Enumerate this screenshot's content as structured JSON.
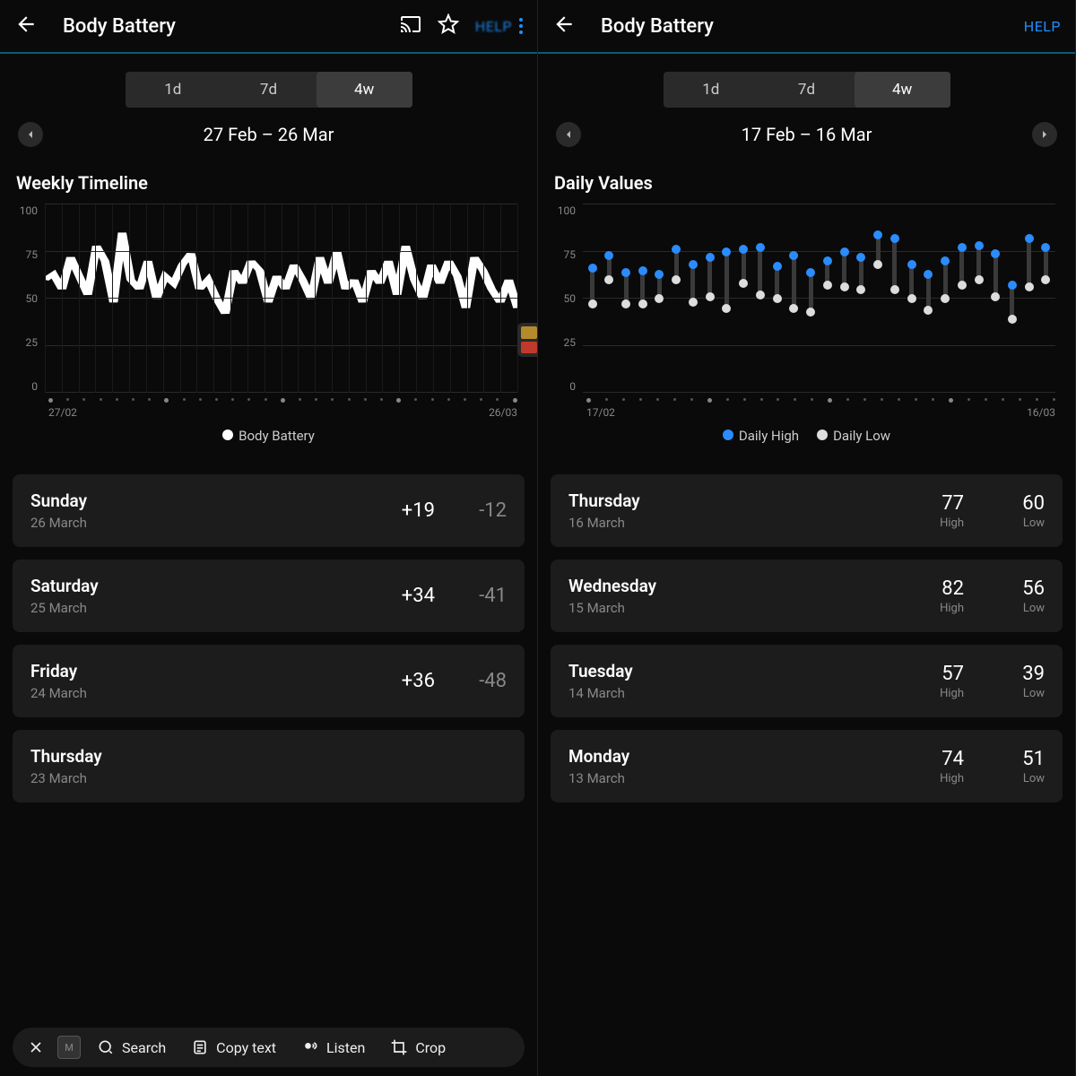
{
  "left": {
    "title": "Body Battery",
    "help": "HELP",
    "tabs": [
      "1d",
      "7d",
      "4w"
    ],
    "activeTab": "4w",
    "dateRange": "27 Feb – 26 Mar",
    "section": "Weekly Timeline",
    "legend": "Body Battery",
    "xaxis": {
      "start": "27/02",
      "end": "26/03"
    },
    "rows": [
      {
        "day": "Sunday",
        "date": "26 March",
        "pos": "+19",
        "neg": "-12"
      },
      {
        "day": "Saturday",
        "date": "25 March",
        "pos": "+34",
        "neg": "-41"
      },
      {
        "day": "Friday",
        "date": "24 March",
        "pos": "+36",
        "neg": "-48"
      },
      {
        "day": "Thursday",
        "date": "23 March",
        "pos": "",
        "neg": ""
      }
    ],
    "toolbar": {
      "close": "×",
      "search": "Search",
      "copy": "Copy text",
      "listen": "Listen",
      "crop": "Crop"
    }
  },
  "right": {
    "title": "Body Battery",
    "help": "HELP",
    "tabs": [
      "1d",
      "7d",
      "4w"
    ],
    "activeTab": "4w",
    "dateRange": "17 Feb – 16 Mar",
    "section": "Daily Values",
    "legend": {
      "hi": "Daily High",
      "lo": "Daily Low"
    },
    "xaxis": {
      "start": "17/02",
      "end": "16/03"
    },
    "rows": [
      {
        "day": "Thursday",
        "date": "16 March",
        "hi": "77",
        "lo": "60"
      },
      {
        "day": "Wednesday",
        "date": "15 March",
        "hi": "82",
        "lo": "56"
      },
      {
        "day": "Tuesday",
        "date": "14 March",
        "hi": "57",
        "lo": "39"
      },
      {
        "day": "Monday",
        "date": "13 March",
        "hi": "74",
        "lo": "51"
      }
    ]
  },
  "chart_data": [
    {
      "type": "line",
      "title": "Weekly Timeline",
      "ylabel": "Body Battery",
      "ylim": [
        0,
        100
      ],
      "x_start": "27/02",
      "x_end": "26/03",
      "series": [
        {
          "name": "Body Battery",
          "values": [
            60,
            63,
            55,
            72,
            62,
            52,
            78,
            70,
            48,
            85,
            60,
            55,
            70,
            50,
            62,
            58,
            68,
            74,
            55,
            60,
            50,
            42,
            65,
            58,
            70,
            65,
            48,
            62,
            55,
            68,
            60,
            50,
            72,
            58,
            75,
            55,
            60,
            48,
            65,
            58,
            70,
            52,
            78,
            60,
            50,
            68,
            58,
            70,
            62,
            45,
            72,
            65,
            55,
            48,
            60,
            45
          ]
        }
      ]
    },
    {
      "type": "scatter",
      "title": "Daily Values",
      "ylabel": "",
      "ylim": [
        0,
        100
      ],
      "categories": [
        "17/02",
        "18/02",
        "19/02",
        "20/02",
        "21/02",
        "22/02",
        "23/02",
        "24/02",
        "25/02",
        "26/02",
        "27/02",
        "28/02",
        "01/03",
        "02/03",
        "03/03",
        "04/03",
        "05/03",
        "06/03",
        "07/03",
        "08/03",
        "09/03",
        "10/03",
        "11/03",
        "12/03",
        "13/03",
        "14/03",
        "15/03",
        "16/03"
      ],
      "series": [
        {
          "name": "Daily High",
          "values": [
            66,
            73,
            64,
            65,
            63,
            76,
            68,
            72,
            75,
            76,
            77,
            67,
            73,
            64,
            70,
            75,
            72,
            84,
            82,
            68,
            63,
            70,
            77,
            78,
            74,
            57,
            82,
            77
          ]
        },
        {
          "name": "Daily Low",
          "values": [
            47,
            60,
            47,
            47,
            50,
            60,
            48,
            51,
            45,
            58,
            52,
            50,
            45,
            43,
            57,
            56,
            55,
            68,
            55,
            50,
            44,
            50,
            57,
            60,
            51,
            39,
            56,
            60
          ]
        }
      ]
    }
  ]
}
